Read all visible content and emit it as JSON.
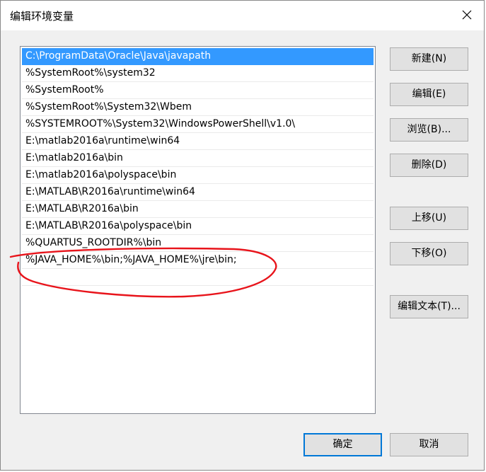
{
  "window": {
    "title": "编辑环境变量"
  },
  "list": {
    "items": [
      {
        "text": "C:\\ProgramData\\Oracle\\Java\\javapath",
        "selected": true
      },
      {
        "text": "%SystemRoot%\\system32"
      },
      {
        "text": "%SystemRoot%"
      },
      {
        "text": "%SystemRoot%\\System32\\Wbem"
      },
      {
        "text": "%SYSTEMROOT%\\System32\\WindowsPowerShell\\v1.0\\"
      },
      {
        "text": "E:\\matlab2016a\\runtime\\win64"
      },
      {
        "text": "E:\\matlab2016a\\bin"
      },
      {
        "text": "E:\\matlab2016a\\polyspace\\bin"
      },
      {
        "text": "E:\\MATLAB\\R2016a\\runtime\\win64"
      },
      {
        "text": "E:\\MATLAB\\R2016a\\bin"
      },
      {
        "text": "E:\\MATLAB\\R2016a\\polyspace\\bin"
      },
      {
        "text": "%QUARTUS_ROOTDIR%\\bin"
      },
      {
        "text": "%JAVA_HOME%\\bin;%JAVA_HOME%\\jre\\bin;"
      }
    ]
  },
  "buttons": {
    "new": "新建(N)",
    "edit": "编辑(E)",
    "browse": "浏览(B)...",
    "delete": "删除(D)",
    "move_up": "上移(U)",
    "move_down": "下移(O)",
    "edit_text": "编辑文本(T)...",
    "ok": "确定",
    "cancel": "取消"
  },
  "colors": {
    "selection": "#3399ff",
    "annotation": "#e8141b",
    "default_button_border": "#0078d7"
  },
  "icons": {
    "close": "close-icon"
  }
}
